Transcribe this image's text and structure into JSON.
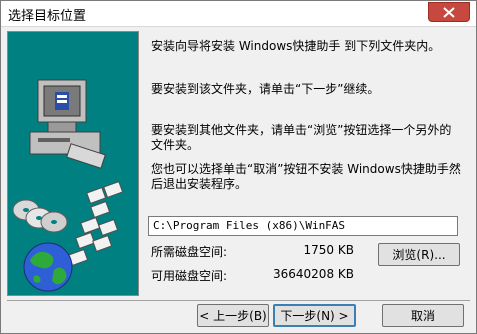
{
  "window": {
    "title": "选择目标位置"
  },
  "messages": {
    "line1": "安装向导将安装 Windows快捷助手 到下列文件夹内。",
    "line2": "要安装到该文件夹，请单击“下一步”继续。",
    "line3": "要安装到其他文件夹，请单击“浏览”按钮选择一个另外的文件夹。",
    "line4": "您也可以选择单击“取消”按钮不安装 Windows快捷助手然后退出安装程序。"
  },
  "destination": {
    "path": "C:\\Program Files (x86)\\WinFAS"
  },
  "space": {
    "required_label": "所需磁盘空间:",
    "required_value": "1750 KB",
    "available_label": "可用磁盘空间:",
    "available_value": "36640208 KB"
  },
  "buttons": {
    "browse": "浏览(R)...",
    "back": "< 上一步(B)",
    "next": "下一步(N) >",
    "cancel": "取消"
  },
  "colors": {
    "art_background": "#008080",
    "close_button": "#c7483f"
  }
}
